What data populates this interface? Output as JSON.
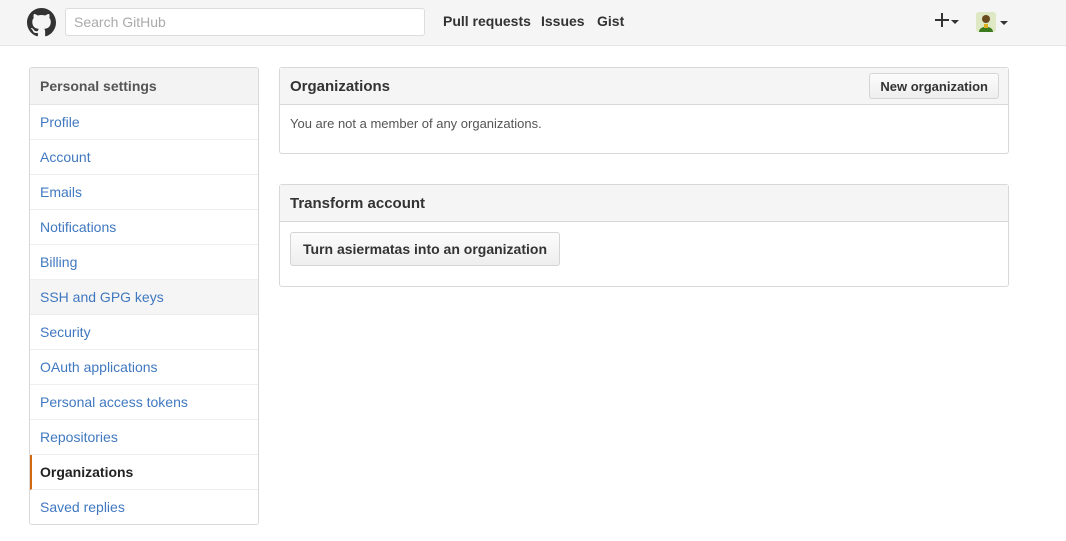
{
  "header": {
    "search_placeholder": "Search GitHub",
    "nav": [
      "Pull requests",
      "Issues",
      "Gist"
    ],
    "plus_icon": "plus-icon",
    "avatar_icon": "user-avatar"
  },
  "sidebar": {
    "heading": "Personal settings",
    "items": [
      {
        "label": "Profile"
      },
      {
        "label": "Account"
      },
      {
        "label": "Emails"
      },
      {
        "label": "Notifications"
      },
      {
        "label": "Billing"
      },
      {
        "label": "SSH and GPG keys"
      },
      {
        "label": "Security"
      },
      {
        "label": "OAuth applications"
      },
      {
        "label": "Personal access tokens"
      },
      {
        "label": "Repositories"
      },
      {
        "label": "Organizations"
      },
      {
        "label": "Saved replies"
      }
    ],
    "selected": "Organizations",
    "accent_color": "#d26911"
  },
  "organizations": {
    "title": "Organizations",
    "new_button": "New organization",
    "empty_message": "You are not a member of any organizations."
  },
  "transform": {
    "title": "Transform account",
    "button": "Turn asiermatas into an organization"
  },
  "colors": {
    "link": "#4078c0",
    "header_bg": "#f5f5f5"
  }
}
